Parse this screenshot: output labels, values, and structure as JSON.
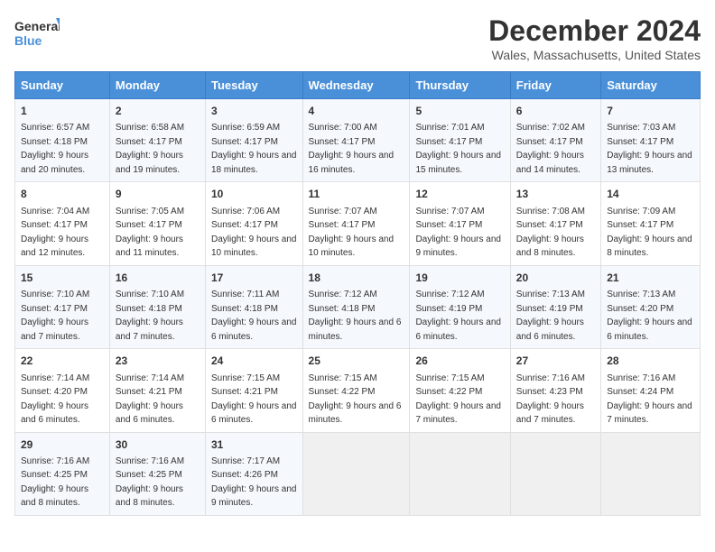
{
  "logo": {
    "line1": "General",
    "line2": "Blue"
  },
  "title": "December 2024",
  "subtitle": "Wales, Massachusetts, United States",
  "days_of_week": [
    "Sunday",
    "Monday",
    "Tuesday",
    "Wednesday",
    "Thursday",
    "Friday",
    "Saturday"
  ],
  "weeks": [
    [
      {
        "day": "1",
        "sunrise": "6:57 AM",
        "sunset": "4:18 PM",
        "daylight": "9 hours and 20 minutes."
      },
      {
        "day": "2",
        "sunrise": "6:58 AM",
        "sunset": "4:17 PM",
        "daylight": "9 hours and 19 minutes."
      },
      {
        "day": "3",
        "sunrise": "6:59 AM",
        "sunset": "4:17 PM",
        "daylight": "9 hours and 18 minutes."
      },
      {
        "day": "4",
        "sunrise": "7:00 AM",
        "sunset": "4:17 PM",
        "daylight": "9 hours and 16 minutes."
      },
      {
        "day": "5",
        "sunrise": "7:01 AM",
        "sunset": "4:17 PM",
        "daylight": "9 hours and 15 minutes."
      },
      {
        "day": "6",
        "sunrise": "7:02 AM",
        "sunset": "4:17 PM",
        "daylight": "9 hours and 14 minutes."
      },
      {
        "day": "7",
        "sunrise": "7:03 AM",
        "sunset": "4:17 PM",
        "daylight": "9 hours and 13 minutes."
      }
    ],
    [
      {
        "day": "8",
        "sunrise": "7:04 AM",
        "sunset": "4:17 PM",
        "daylight": "9 hours and 12 minutes."
      },
      {
        "day": "9",
        "sunrise": "7:05 AM",
        "sunset": "4:17 PM",
        "daylight": "9 hours and 11 minutes."
      },
      {
        "day": "10",
        "sunrise": "7:06 AM",
        "sunset": "4:17 PM",
        "daylight": "9 hours and 10 minutes."
      },
      {
        "day": "11",
        "sunrise": "7:07 AM",
        "sunset": "4:17 PM",
        "daylight": "9 hours and 10 minutes."
      },
      {
        "day": "12",
        "sunrise": "7:07 AM",
        "sunset": "4:17 PM",
        "daylight": "9 hours and 9 minutes."
      },
      {
        "day": "13",
        "sunrise": "7:08 AM",
        "sunset": "4:17 PM",
        "daylight": "9 hours and 8 minutes."
      },
      {
        "day": "14",
        "sunrise": "7:09 AM",
        "sunset": "4:17 PM",
        "daylight": "9 hours and 8 minutes."
      }
    ],
    [
      {
        "day": "15",
        "sunrise": "7:10 AM",
        "sunset": "4:17 PM",
        "daylight": "9 hours and 7 minutes."
      },
      {
        "day": "16",
        "sunrise": "7:10 AM",
        "sunset": "4:18 PM",
        "daylight": "9 hours and 7 minutes."
      },
      {
        "day": "17",
        "sunrise": "7:11 AM",
        "sunset": "4:18 PM",
        "daylight": "9 hours and 6 minutes."
      },
      {
        "day": "18",
        "sunrise": "7:12 AM",
        "sunset": "4:18 PM",
        "daylight": "9 hours and 6 minutes."
      },
      {
        "day": "19",
        "sunrise": "7:12 AM",
        "sunset": "4:19 PM",
        "daylight": "9 hours and 6 minutes."
      },
      {
        "day": "20",
        "sunrise": "7:13 AM",
        "sunset": "4:19 PM",
        "daylight": "9 hours and 6 minutes."
      },
      {
        "day": "21",
        "sunrise": "7:13 AM",
        "sunset": "4:20 PM",
        "daylight": "9 hours and 6 minutes."
      }
    ],
    [
      {
        "day": "22",
        "sunrise": "7:14 AM",
        "sunset": "4:20 PM",
        "daylight": "9 hours and 6 minutes."
      },
      {
        "day": "23",
        "sunrise": "7:14 AM",
        "sunset": "4:21 PM",
        "daylight": "9 hours and 6 minutes."
      },
      {
        "day": "24",
        "sunrise": "7:15 AM",
        "sunset": "4:21 PM",
        "daylight": "9 hours and 6 minutes."
      },
      {
        "day": "25",
        "sunrise": "7:15 AM",
        "sunset": "4:22 PM",
        "daylight": "9 hours and 6 minutes."
      },
      {
        "day": "26",
        "sunrise": "7:15 AM",
        "sunset": "4:22 PM",
        "daylight": "9 hours and 7 minutes."
      },
      {
        "day": "27",
        "sunrise": "7:16 AM",
        "sunset": "4:23 PM",
        "daylight": "9 hours and 7 minutes."
      },
      {
        "day": "28",
        "sunrise": "7:16 AM",
        "sunset": "4:24 PM",
        "daylight": "9 hours and 7 minutes."
      }
    ],
    [
      {
        "day": "29",
        "sunrise": "7:16 AM",
        "sunset": "4:25 PM",
        "daylight": "9 hours and 8 minutes."
      },
      {
        "day": "30",
        "sunrise": "7:16 AM",
        "sunset": "4:25 PM",
        "daylight": "9 hours and 8 minutes."
      },
      {
        "day": "31",
        "sunrise": "7:17 AM",
        "sunset": "4:26 PM",
        "daylight": "9 hours and 9 minutes."
      },
      null,
      null,
      null,
      null
    ]
  ],
  "labels": {
    "sunrise": "Sunrise:",
    "sunset": "Sunset:",
    "daylight": "Daylight:"
  }
}
